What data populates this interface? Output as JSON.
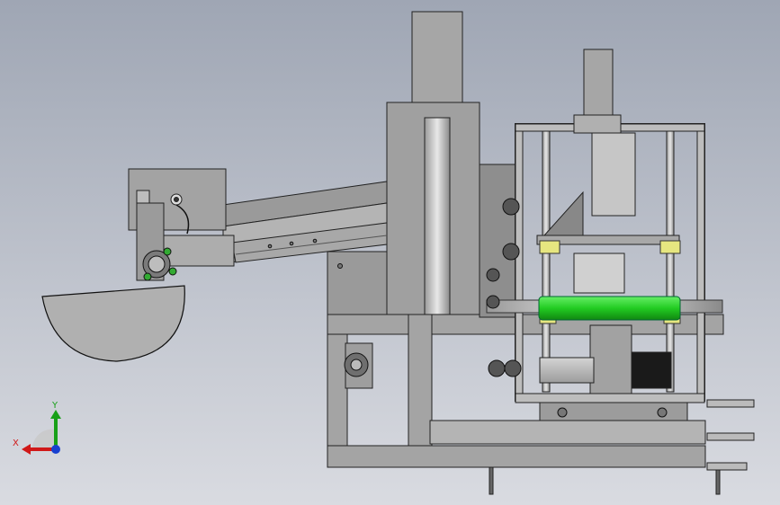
{
  "viewport": {
    "background_top": "#9fa6b4",
    "background_bottom": "#d9dbe1"
  },
  "triad": {
    "x_label": "X",
    "y_label": "Y",
    "x_color": "#d01818",
    "y_color": "#18a018",
    "z_color": "#1840d0"
  },
  "model": {
    "frame_color": "#8c8c8c",
    "roller_color": "#22cc22",
    "bushing_color": "#e6e680",
    "motor_color": "#1a1a1a"
  }
}
